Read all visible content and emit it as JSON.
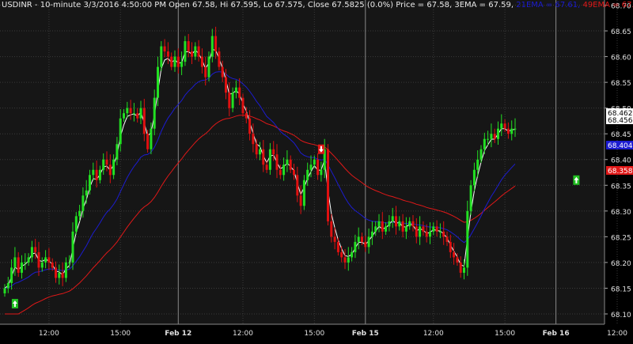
{
  "header": {
    "title": "USDINR - 10-minute 3/3/2016 4:50:00 PM Open 67.58, Hi 67.595, Lo 67.575, Close 67.5825 (0.0%) Price = 67.58, 3EMA = 67.59, ",
    "ema2_label": "21EMA = 67.61,",
    "ema3_label": " 49EMA = 67.67",
    "colors": {
      "title": "#e8e8e8",
      "ema2": "#1c1cd0",
      "ema3": "#e01818"
    }
  },
  "chart_data": {
    "type": "candlestick",
    "symbol": "USDINR",
    "interval": "10-minute",
    "ylim": [
      68.08,
      68.71
    ],
    "y_ticks": [
      68.1,
      68.15,
      68.2,
      68.25,
      68.3,
      68.35,
      68.4,
      68.45,
      68.5,
      68.55,
      68.6,
      68.65,
      68.7
    ],
    "y_tick_labels": [
      "68.10",
      "68.15",
      "68.20",
      "68.25",
      "68.30",
      "68.35",
      "68.40",
      "68.45",
      "68.50",
      "68.55",
      "68.60",
      "68.65",
      "68.70"
    ],
    "x_tick_labels": [
      "12:00",
      "15:00",
      "Feb 12",
      "12:00",
      "15:00",
      "Feb 15",
      "12:00",
      "15:00",
      "Feb 16",
      "12:00"
    ],
    "x_tick_bars": [
      13,
      34,
      51,
      70,
      91,
      106,
      126,
      147,
      162,
      180
    ],
    "price_tags": [
      {
        "label": "68.4625",
        "value": 68.4625,
        "color": "#ffffff",
        "text_color": "#000000"
      },
      {
        "label": "68.4562",
        "value": 68.4562,
        "color": "#ffffff",
        "text_color": "#000000"
      },
      {
        "label": "68.4048",
        "value": 68.4048,
        "color": "#1c1cd0",
        "text_color": "#ffffff"
      },
      {
        "label": "68.3586",
        "value": 68.3586,
        "color": "#e01818",
        "text_color": "#ffffff"
      }
    ],
    "series": [
      {
        "name": "3EMA",
        "color": "#ffffff"
      },
      {
        "name": "21EMA",
        "color": "#1c1cd0"
      },
      {
        "name": "49EMA",
        "color": "#e01818"
      }
    ],
    "closes": [
      68.15,
      68.16,
      68.19,
      68.21,
      68.18,
      68.2,
      68.2,
      68.21,
      68.23,
      68.22,
      68.19,
      68.2,
      68.21,
      68.2,
      68.19,
      68.17,
      68.18,
      68.17,
      68.2,
      68.2,
      68.26,
      68.29,
      68.3,
      68.33,
      68.34,
      68.37,
      68.38,
      68.36,
      68.38,
      68.4,
      68.39,
      68.37,
      68.4,
      68.43,
      68.48,
      68.49,
      68.5,
      68.49,
      68.49,
      68.48,
      68.5,
      68.45,
      68.42,
      68.46,
      68.52,
      68.58,
      68.62,
      68.61,
      68.6,
      68.58,
      68.6,
      68.58,
      68.59,
      68.63,
      68.61,
      68.6,
      68.62,
      68.6,
      68.58,
      68.56,
      68.6,
      68.64,
      68.61,
      68.58,
      68.56,
      68.53,
      68.5,
      68.53,
      68.54,
      68.52,
      68.49,
      68.48,
      68.45,
      68.43,
      68.41,
      68.42,
      68.39,
      68.38,
      68.42,
      68.41,
      68.38,
      68.37,
      68.39,
      68.4,
      68.38,
      68.37,
      68.33,
      68.31,
      68.36,
      68.38,
      68.39,
      68.4,
      68.37,
      68.38,
      68.42,
      68.28,
      68.25,
      68.24,
      68.22,
      68.21,
      68.2,
      68.21,
      68.22,
      68.24,
      68.25,
      68.24,
      68.23,
      68.25,
      68.26,
      68.27,
      68.28,
      68.26,
      68.27,
      68.28,
      68.29,
      68.27,
      68.28,
      68.26,
      68.27,
      68.28,
      68.27,
      68.25,
      68.27,
      68.26,
      68.25,
      68.26,
      68.27,
      68.26,
      68.26,
      68.25,
      68.24,
      68.22,
      68.21,
      68.2,
      68.18,
      68.19,
      68.3,
      68.35,
      68.38,
      68.4,
      68.42,
      68.44,
      68.44,
      68.45,
      68.44,
      68.46,
      68.47,
      68.46,
      68.45,
      68.46,
      68.46
    ],
    "signals": [
      {
        "type": "buy",
        "bar": 3,
        "price": 68.12
      },
      {
        "type": "sell",
        "bar": 93,
        "price": 68.42
      },
      {
        "type": "buy",
        "bar": 168,
        "price": 68.36
      }
    ]
  }
}
